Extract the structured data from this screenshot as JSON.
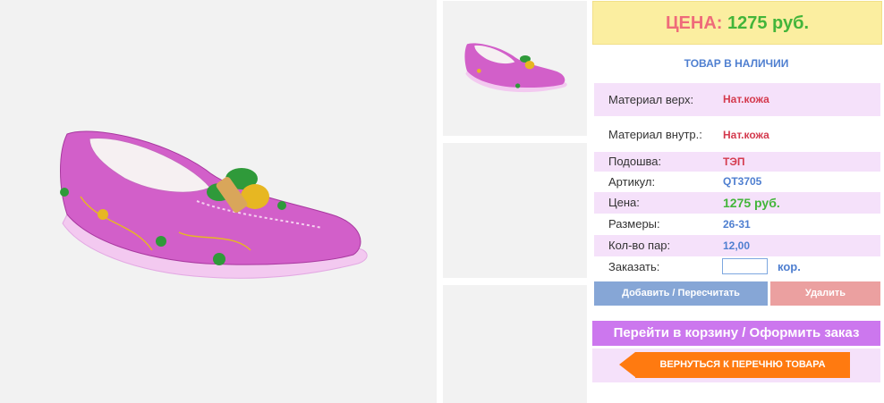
{
  "product": {
    "price_label": "ЦЕНА:",
    "price_value": "1275 руб.",
    "stock_status": "ТОВАР В НАЛИЧИИ"
  },
  "specs": [
    {
      "label": "Материал верх:",
      "value": "Нат.кожа"
    },
    {
      "label": "Материал внутр.:",
      "value": "Нат.кожа"
    },
    {
      "label": "Подошва:",
      "value": "ТЭП"
    },
    {
      "label": "Артикул:",
      "value": "QT3705"
    },
    {
      "label": "Цена:",
      "value": "1275 руб."
    },
    {
      "label": "Размеры:",
      "value": "26-31"
    },
    {
      "label": "Кол-во пар:",
      "value": "12,00"
    }
  ],
  "order": {
    "label": "Заказать:",
    "input_value": "",
    "unit": "кор."
  },
  "buttons": {
    "add": "Добавить / Пересчитать",
    "delete": "Удалить",
    "cart": "Перейти в корзину / Оформить заказ",
    "back": "ВЕРНУТЬСЯ К ПЕРЕЧНЮ ТОВАРА"
  },
  "colors": {
    "accent_pink": "#cc77ee",
    "price_green": "#43b53a",
    "back_orange": "#ff7a10",
    "row_pink": "#f5e1fa"
  },
  "icons": [
    "shoe-image",
    "shoe-thumbnail",
    "back-arrow-icon"
  ]
}
